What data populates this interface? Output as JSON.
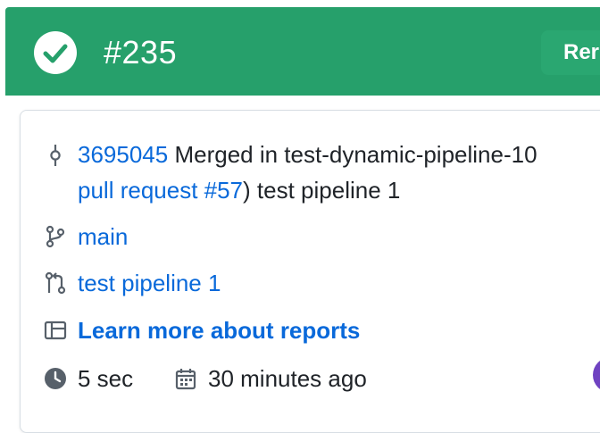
{
  "header": {
    "run_number": "#235",
    "rerun_label": "Rerun",
    "status": "success",
    "status_color": "#26a06b",
    "status_icon": "check-circle-icon"
  },
  "details": {
    "commit": {
      "sha": "3695045",
      "message_part1": "Merged in test-dynamic-pipeline-10",
      "pull_request_link": "pull request #57",
      "message_part2": ") test pipeline 1",
      "icon": "commit-icon"
    },
    "branch": {
      "name": "main",
      "icon": "branch-icon"
    },
    "pull_request": {
      "title": "test pipeline 1",
      "icon": "pull-request-icon"
    },
    "reports_link": {
      "label": "Learn more about reports",
      "icon": "reports-icon"
    },
    "duration": {
      "value": "5 sec",
      "icon": "clock-icon"
    },
    "created": {
      "value": "30 minutes ago",
      "icon": "calendar-icon"
    }
  },
  "colors": {
    "link": "#0969da",
    "header_bg": "#26a06b"
  }
}
